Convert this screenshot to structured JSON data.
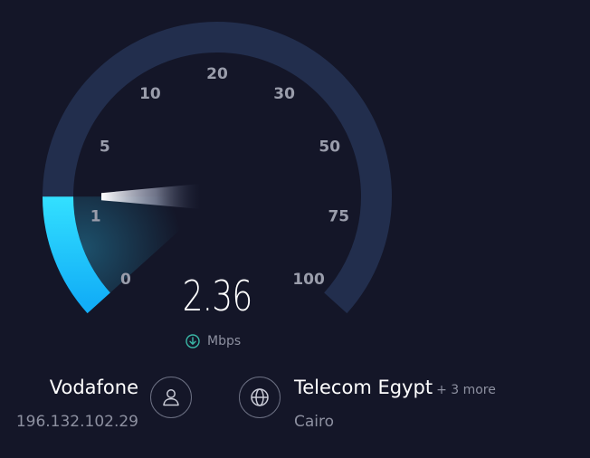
{
  "gauge": {
    "ticks": [
      "0",
      "1",
      "5",
      "10",
      "20",
      "30",
      "50",
      "75",
      "100"
    ],
    "current_tick_position": 1.27,
    "speed_value": "2.36",
    "unit": "Mbps",
    "colors": {
      "track": "#222e4d",
      "fill_start": "#1bb6f7",
      "fill_end": "#2fe1ff",
      "background": "#141628"
    }
  },
  "isp": {
    "name": "Vodafone",
    "ip": "196.132.102.29",
    "icon": "user-icon"
  },
  "server": {
    "name": "Telecom Egypt",
    "more": "+ 3 more",
    "city": "Cairo",
    "icon": "globe-icon"
  }
}
